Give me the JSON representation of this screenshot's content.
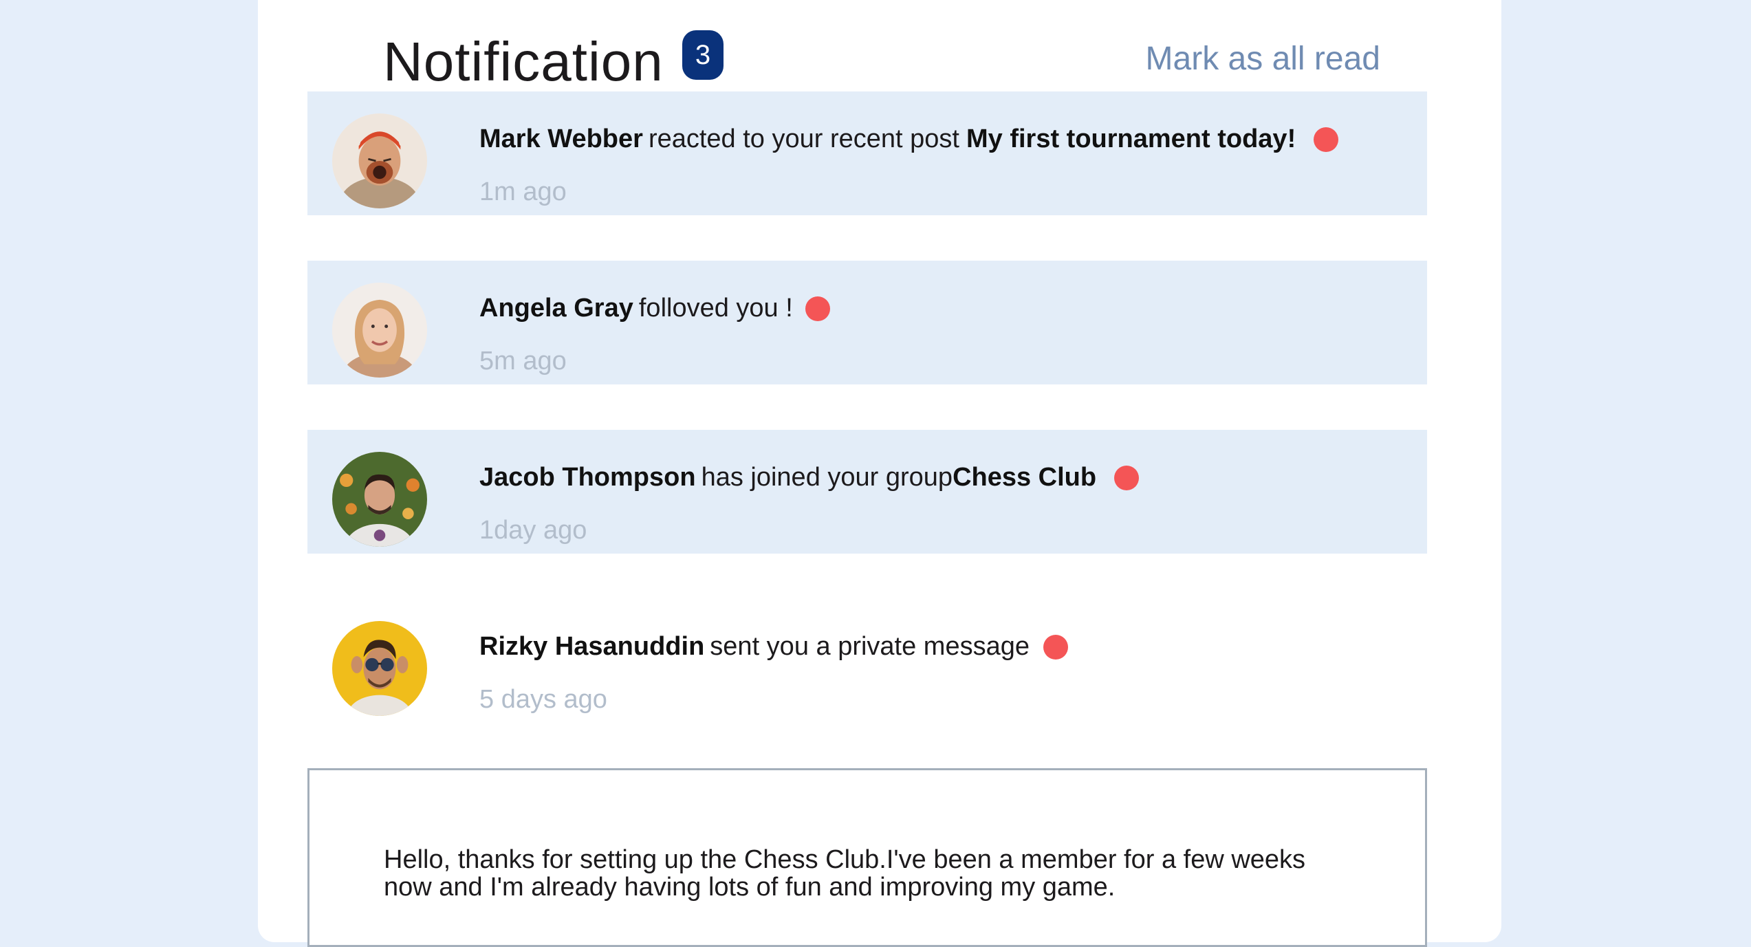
{
  "header": {
    "title": "Notification",
    "badge_count": "3",
    "mark_all_label": "Mark as all read"
  },
  "notifications": [
    {
      "name": "Mark Webber",
      "action": "reacted to your recent post",
      "target": "My first tournament today!",
      "time": "1m ago",
      "unread": true,
      "avatar_icon": "avatar-mark-webber"
    },
    {
      "name": "Angela Gray",
      "action": "folloved you !",
      "target": "",
      "time": "5m ago",
      "unread": true,
      "avatar_icon": "avatar-angela-gray"
    },
    {
      "name": "Jacob Thompson",
      "action": "has joined your group",
      "target": "Chess Club",
      "time": "1day ago",
      "unread": true,
      "avatar_icon": "avatar-jacob-thompson"
    },
    {
      "name": "Rizky Hasanuddin",
      "action": "sent you a private message",
      "target": "",
      "time": "5 days ago",
      "unread": false,
      "avatar_icon": "avatar-rizky-hasanuddin"
    }
  ],
  "message": {
    "text": "Hello, thanks for setting up the Chess Club.I've been a member for a few weeks now and I'm already having lots of fun and improving my game."
  },
  "colors": {
    "page_bg": "#e5eefa",
    "unread_bg": "#e3edf8",
    "badge_bg": "#0a327b",
    "dot": "#f45556",
    "muted": "#b2bdcb",
    "link": "#6f8bb2"
  }
}
